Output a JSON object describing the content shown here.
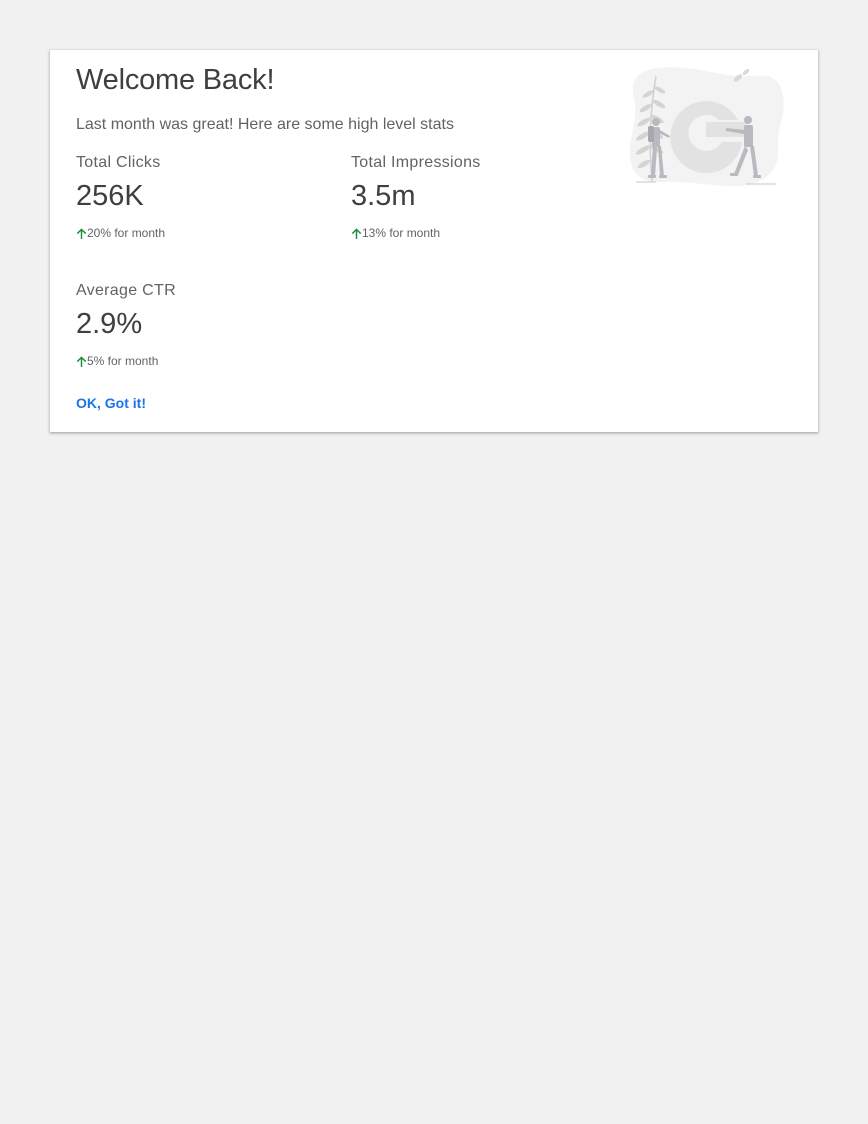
{
  "card": {
    "title": "Welcome Back!",
    "subtitle": "Last month was great! Here are some high level stats",
    "stats": [
      {
        "label": "Total Clicks",
        "value": "256K",
        "change": "20% for month",
        "direction": "up"
      },
      {
        "label": "Total Impressions",
        "value": "3.5m",
        "change": "13% for month",
        "direction": "up"
      },
      {
        "label": "Average CTR",
        "value": "2.9%",
        "change": "5% for month",
        "direction": "up"
      }
    ],
    "ok_label": "OK, Got it!",
    "illustration_icon": "google-g-hikers-illustration"
  },
  "colors": {
    "background": "#f1f1f1",
    "card": "#ffffff",
    "text_primary": "#3c4043",
    "text_secondary": "#5f6368",
    "accent": "#1a73e8",
    "positive": "#1e8e3e",
    "illustration_gray": "#e0e0e0"
  }
}
